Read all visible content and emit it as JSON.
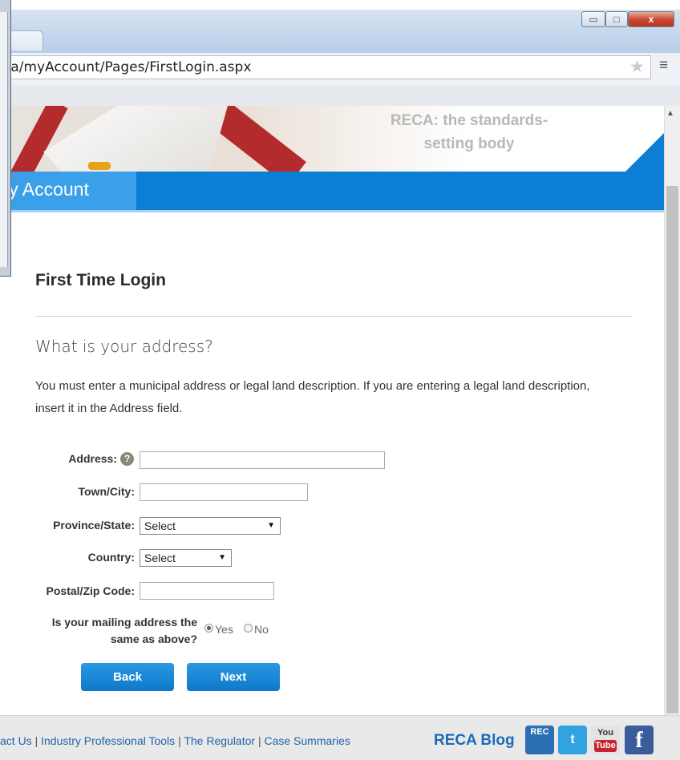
{
  "browser": {
    "url": "ca/myAccount/Pages/FirstLogin.aspx",
    "min_glyph": "▭",
    "max_glyph": "□",
    "close_glyph": "x"
  },
  "banner": {
    "caption_line1": "RECA: the standards-",
    "caption_line2": "setting body"
  },
  "nav": {
    "title": "ly Account"
  },
  "page": {
    "title": "First Time Login",
    "question": "What is your address?",
    "instructions": "You must enter a municipal address or legal land description. If you are entering a legal land description, insert it in the Address field."
  },
  "form": {
    "address_label": "Address:",
    "address_value": "",
    "town_label": "Town/City:",
    "town_value": "",
    "province_label": "Province/State:",
    "province_value": "Select",
    "country_label": "Country:",
    "country_value": "Select",
    "postal_label": "Postal/Zip Code:",
    "postal_value": "",
    "mailing_label_line1": "Is your mailing address the",
    "mailing_label_line2": "same as above?",
    "yes_label": "Yes",
    "no_label": "No",
    "mailing_selected": "Yes",
    "back_label": "Back",
    "next_label": "Next"
  },
  "footer": {
    "links": [
      "act Us",
      "Industry Professional Tools",
      "The Regulator",
      "Case Summaries"
    ],
    "separator": "|",
    "blog": "RECA Blog",
    "reca_icon_text": "REC",
    "youtube_top": "You",
    "youtube_bottom": "Tube",
    "facebook_glyph": "f",
    "twitter_glyph": "t"
  },
  "icons": {
    "star": "★",
    "menu": "≡",
    "scroll_up": "▲",
    "caret": "▼",
    "help": "?"
  },
  "colors": {
    "nav_blue": "#0a7fd4",
    "button_blue": "#1487d8",
    "link_blue": "#1f64a8",
    "banner_red": "#b42b2e"
  }
}
